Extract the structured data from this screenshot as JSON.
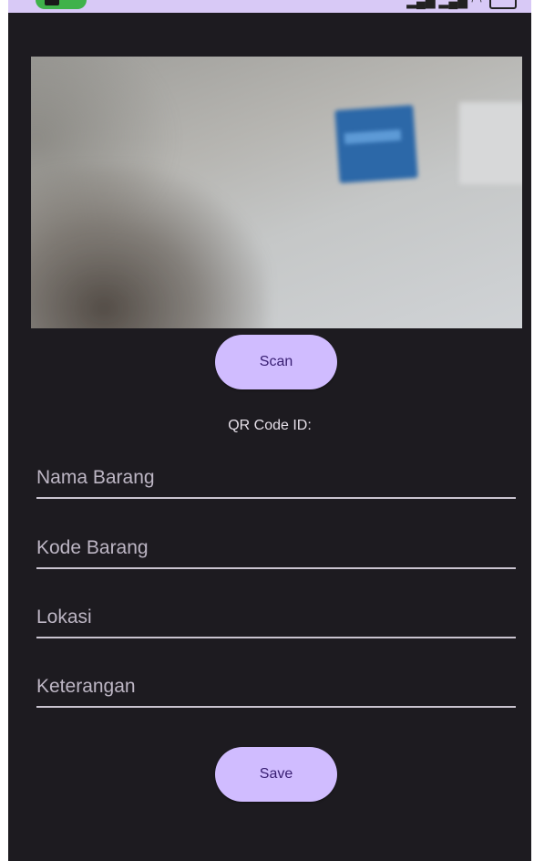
{
  "form": {
    "scan_label": "Scan",
    "qr_label": "QR Code ID:",
    "fields": [
      {
        "placeholder": "Nama Barang",
        "value": ""
      },
      {
        "placeholder": "Kode Barang",
        "value": ""
      },
      {
        "placeholder": "Lokasi",
        "value": ""
      },
      {
        "placeholder": "Keterangan",
        "value": ""
      }
    ],
    "save_label": "Save"
  },
  "colors": {
    "background": "#1d1b20",
    "button": "#d0bcff",
    "button_text": "#381e72",
    "field_underline": "#cac4d0",
    "status_bar": "#d8c9f6"
  },
  "icons": [
    "signal-icon",
    "wifi-icon",
    "battery-icon"
  ]
}
